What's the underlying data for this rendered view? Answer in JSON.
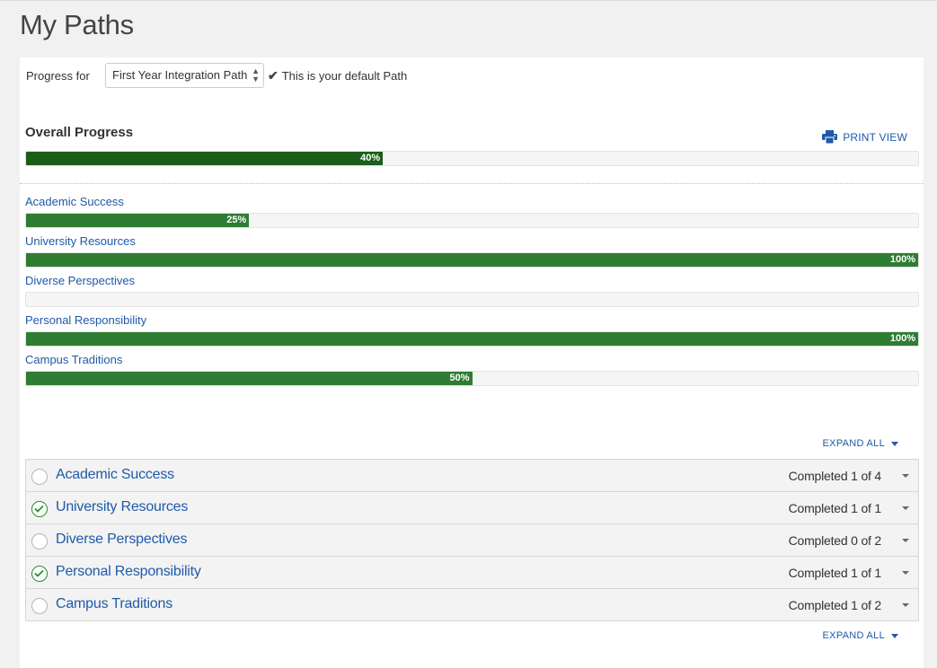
{
  "page": {
    "title": "My Paths"
  },
  "selector": {
    "label": "Progress for",
    "selected": "First Year Integration Path",
    "default_note": "This is your default Path"
  },
  "overall": {
    "title": "Overall Progress",
    "print_label": "PRINT VIEW",
    "percent": 40,
    "percent_label": "40%"
  },
  "categories": [
    {
      "label": "Academic Success",
      "percent": 25,
      "percent_label": "25%"
    },
    {
      "label": "University Resources",
      "percent": 100,
      "percent_label": "100%"
    },
    {
      "label": "Diverse Perspectives",
      "percent": 0,
      "percent_label": ""
    },
    {
      "label": "Personal Responsibility",
      "percent": 100,
      "percent_label": "100%"
    },
    {
      "label": "Campus Traditions",
      "percent": 50,
      "percent_label": "50%"
    }
  ],
  "expand_all_label": "EXPAND ALL",
  "sections": [
    {
      "title": "Academic Success",
      "status": "Completed 1 of 4",
      "complete": false
    },
    {
      "title": "University Resources",
      "status": "Completed 1 of 1",
      "complete": true
    },
    {
      "title": "Diverse Perspectives",
      "status": "Completed 0 of 2",
      "complete": false
    },
    {
      "title": "Personal Responsibility",
      "status": "Completed 1 of 1",
      "complete": true
    },
    {
      "title": "Campus Traditions",
      "status": "Completed 1 of 2",
      "complete": false
    }
  ],
  "icons": {
    "check": "check-icon",
    "print": "printer-icon",
    "caret": "caret-down-icon",
    "status_complete": "check-circle-icon",
    "status_incomplete": "empty-circle-icon"
  },
  "colors": {
    "link": "#1f5aa8",
    "overall_fill": "#1a5e1a",
    "category_fill": "#2e7d32",
    "complete_icon": "#2e8b2e"
  }
}
